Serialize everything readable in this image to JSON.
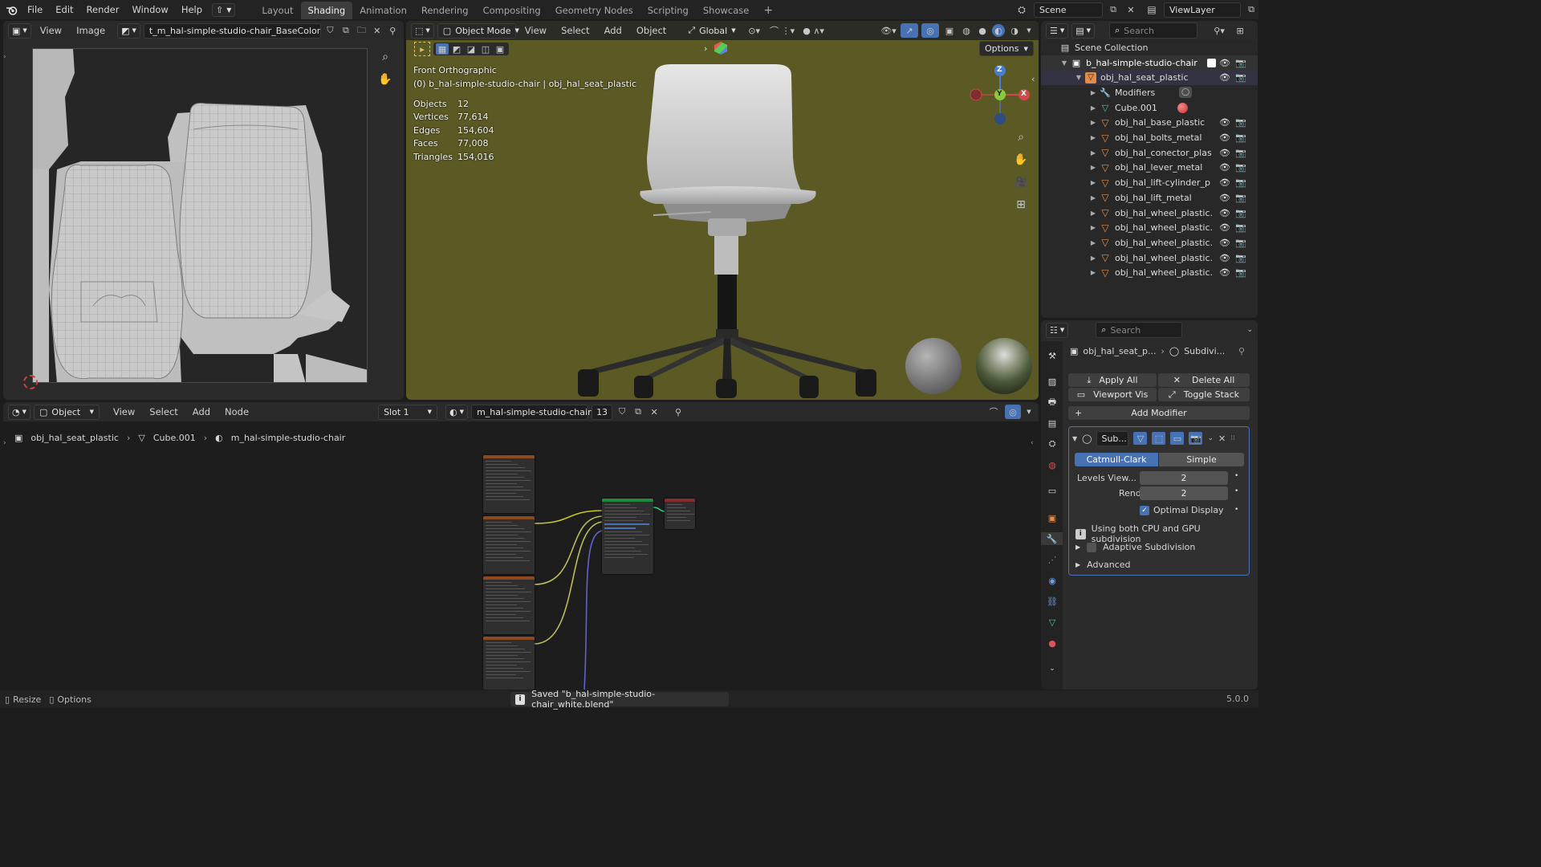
{
  "topbar": {
    "menus": [
      "File",
      "Edit",
      "Render",
      "Window",
      "Help"
    ],
    "workspaces": [
      "Layout",
      "Shading",
      "Animation",
      "Rendering",
      "Compositing",
      "Geometry Nodes",
      "Scripting",
      "Showcase"
    ],
    "active_workspace": "Shading",
    "add_workspace": "+",
    "scene": "Scene",
    "view_layer": "ViewLayer"
  },
  "image_editor": {
    "view": "View",
    "image": "Image",
    "image_name": "t_m_hal-simple-studio-chair_BaseColor.png"
  },
  "viewport": {
    "mode": "Object Mode",
    "menus": [
      "View",
      "Select",
      "Add",
      "Object"
    ],
    "orientation": "Global",
    "options": "Options",
    "view_name": "Front Orthographic",
    "collection_info": "(0) b_hal-simple-studio-chair | obj_hal_seat_plastic",
    "stats": [
      {
        "label": "Objects",
        "value": "12"
      },
      {
        "label": "Vertices",
        "value": "77,614"
      },
      {
        "label": "Edges",
        "value": "154,604"
      },
      {
        "label": "Faces",
        "value": "77,008"
      },
      {
        "label": "Triangles",
        "value": "154,016"
      }
    ],
    "gizmo": {
      "z": "Z",
      "y": "Y",
      "x": "X"
    }
  },
  "outliner": {
    "search_placeholder": "Search",
    "root": "Scene Collection",
    "collection": "b_hal-simple-studio-chair",
    "active_object": "obj_hal_seat_plastic",
    "modifiers": "Modifiers",
    "mesh": "Cube.001",
    "objects": [
      "obj_hal_base_plastic",
      "obj_hal_bolts_metal",
      "obj_hal_conector_plas",
      "obj_hal_lever_metal",
      "obj_hal_lift-cylinder_p",
      "obj_hal_lift_metal",
      "obj_hal_wheel_plastic.",
      "obj_hal_wheel_plastic.",
      "obj_hal_wheel_plastic.",
      "obj_hal_wheel_plastic.",
      "obj_hal_wheel_plastic."
    ]
  },
  "properties": {
    "search_placeholder": "Search",
    "breadcrumb_object": "obj_hal_seat_p...",
    "breadcrumb_modifier": "Subdivi...",
    "apply_all": "Apply All",
    "delete_all": "Delete All",
    "viewport_vis": "Viewport Vis",
    "toggle_stack": "Toggle Stack",
    "add_modifier": "Add Modifier",
    "modifier_name": "Sub...",
    "catmull_clark": "Catmull-Clark",
    "simple": "Simple",
    "levels_viewport_label": "Levels View...",
    "levels_viewport_value": "2",
    "render_label": "Render",
    "render_value": "2",
    "optimal_display": "Optimal Display",
    "info_text": "Using both CPU and GPU subdivision",
    "adaptive_subdivision": "Adaptive Subdivision",
    "advanced": "Advanced"
  },
  "node_editor": {
    "type": "Object",
    "menus": [
      "View",
      "Select",
      "Add",
      "Node"
    ],
    "slot": "Slot 1",
    "material": "m_hal-simple-studio-chair",
    "users": "13",
    "breadcrumb": [
      "obj_hal_seat_plastic",
      "Cube.001",
      "m_hal-simple-studio-chair"
    ]
  },
  "statusbar": {
    "resize": "Resize",
    "options": "Options",
    "message": "Saved \"b_hal-simple-studio-chair_white.blend\"",
    "version": "5.0.0"
  },
  "colors": {
    "accent": "#4772b3",
    "viewport_bg": "#5b5a24",
    "image_bg": "#2b2b2b"
  }
}
